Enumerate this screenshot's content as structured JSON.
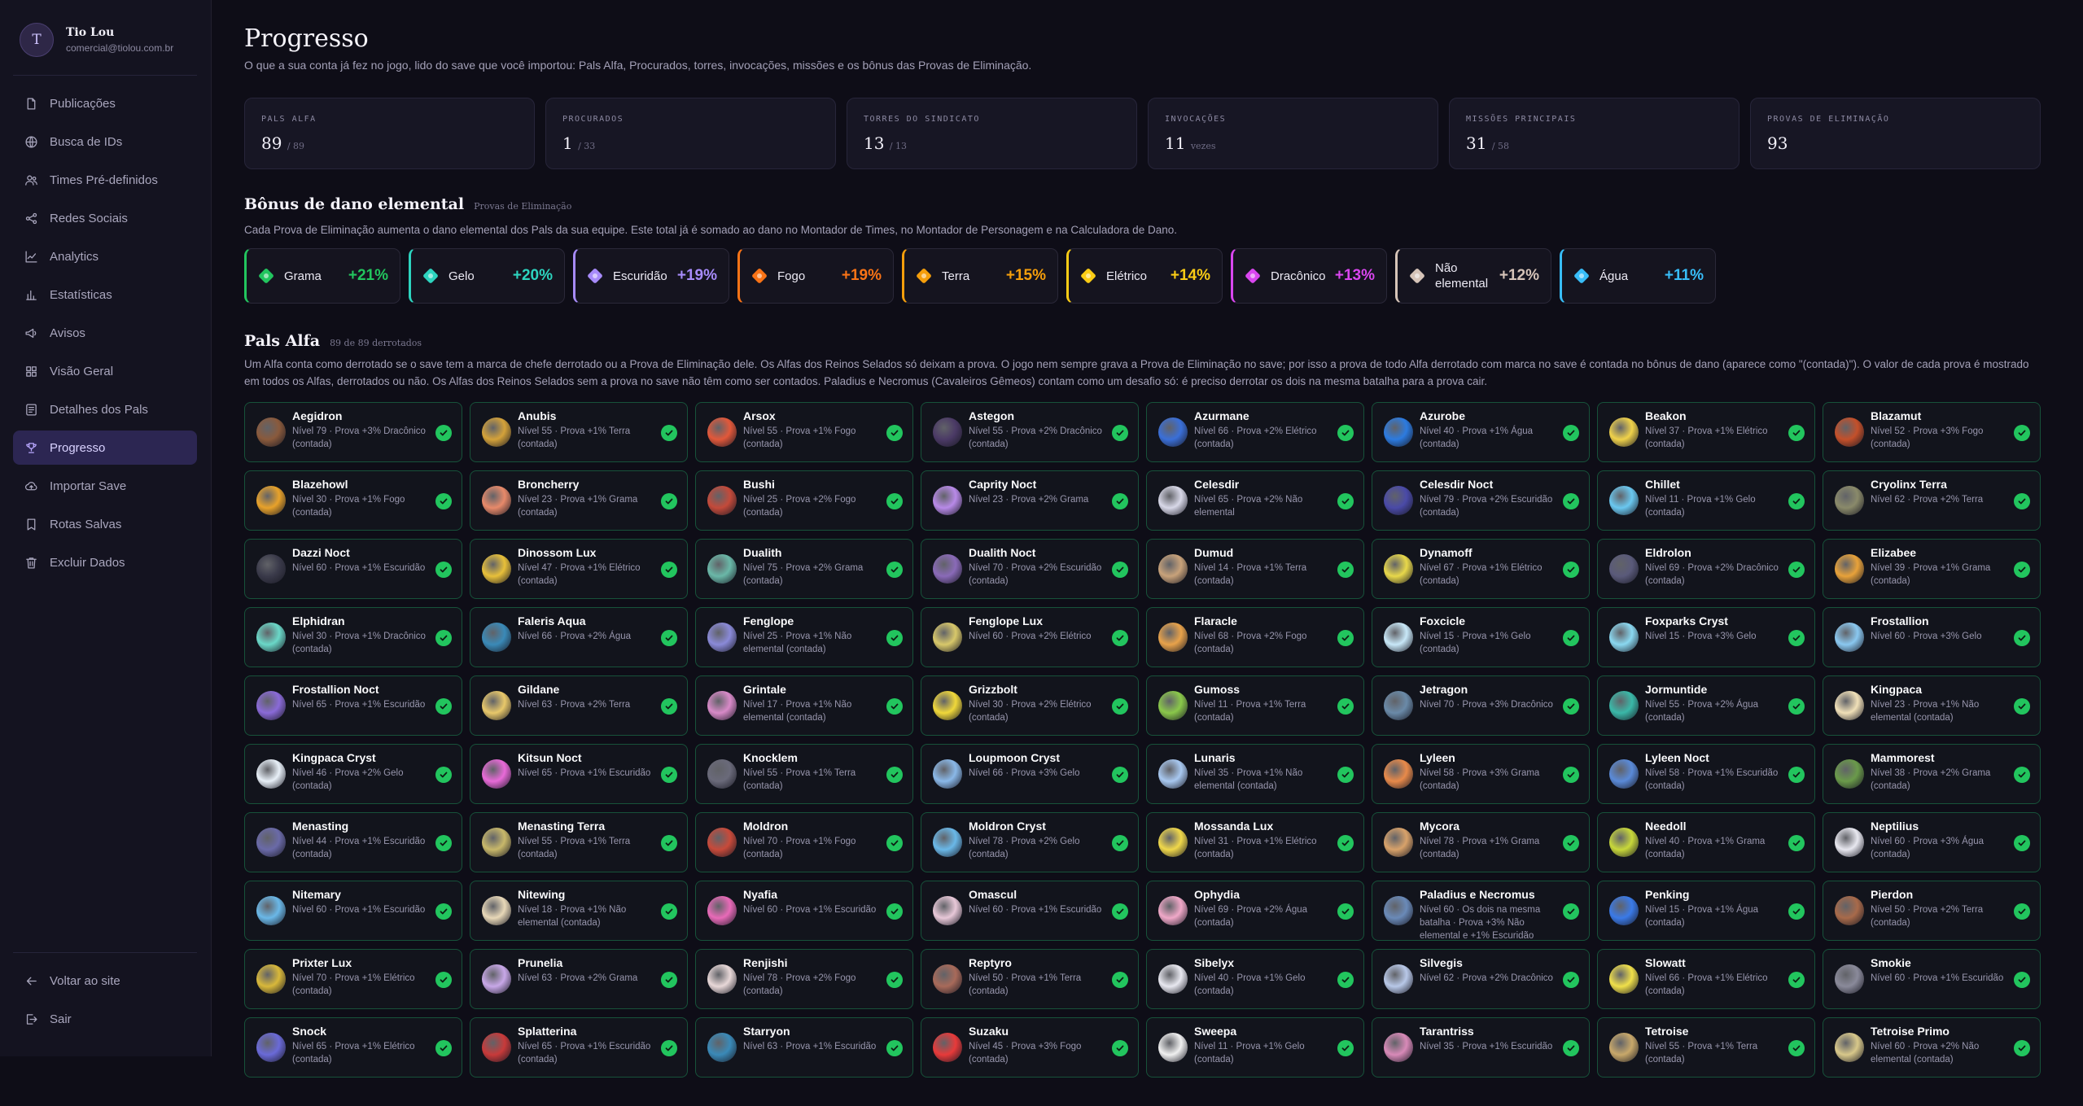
{
  "user": {
    "initial": "T",
    "name": "Tio Lou",
    "email": "comercial@tiolou.com.br"
  },
  "nav": [
    {
      "label": "Publicações",
      "icon": "file-icon"
    },
    {
      "label": "Busca de IDs",
      "icon": "globe-icon"
    },
    {
      "label": "Times Pré-definidos",
      "icon": "users-icon"
    },
    {
      "label": "Redes Sociais",
      "icon": "share-icon"
    },
    {
      "label": "Analytics",
      "icon": "line-chart-icon"
    },
    {
      "label": "Estatísticas",
      "icon": "bar-chart-icon"
    },
    {
      "label": "Avisos",
      "icon": "megaphone-icon"
    },
    {
      "label": "Visão Geral",
      "icon": "grid-icon"
    },
    {
      "label": "Detalhes dos Pals",
      "icon": "list-icon"
    },
    {
      "label": "Progresso",
      "icon": "trophy-icon",
      "active": true
    },
    {
      "label": "Importar Save",
      "icon": "cloud-upload-icon"
    },
    {
      "label": "Rotas Salvas",
      "icon": "bookmark-icon"
    },
    {
      "label": "Excluir Dados",
      "icon": "trash-icon"
    }
  ],
  "nav_bottom": [
    {
      "label": "Voltar ao site",
      "icon": "arrow-left-icon"
    },
    {
      "label": "Sair",
      "icon": "logout-icon"
    }
  ],
  "page": {
    "title": "Progresso",
    "subtitle": "O que a sua conta já fez no jogo, lido do save que você importou: Pals Alfa, Procurados, torres, invocações, missões e os bônus das Provas de Eliminação."
  },
  "stats": [
    {
      "label": "Pals Alfa",
      "value": "89",
      "total": "/ 89"
    },
    {
      "label": "Procurados",
      "value": "1",
      "total": "/ 33"
    },
    {
      "label": "Torres do Sindicato",
      "value": "13",
      "total": "/ 13"
    },
    {
      "label": "Invocações",
      "value": "11",
      "total": "vezes"
    },
    {
      "label": "Missões principais",
      "value": "31",
      "total": "/ 58"
    },
    {
      "label": "Provas de Eliminação",
      "value": "93",
      "total": ""
    }
  ],
  "bonus_section": {
    "title": "Bônus de dano elemental",
    "small": "Provas de Eliminação",
    "desc": "Cada Prova de Eliminação aumenta o dano elemental dos Pals da sua equipe. Este total já é somado ao dano no Montador de Times, no Montador de Personagem e na Calculadora de Dano."
  },
  "bonuses": [
    {
      "name": "Grama",
      "value": "+21%",
      "color": "#22c55e"
    },
    {
      "name": "Gelo",
      "value": "+20%",
      "color": "#2dd4bf"
    },
    {
      "name": "Escuridão",
      "value": "+19%",
      "color": "#a78bfa"
    },
    {
      "name": "Fogo",
      "value": "+19%",
      "color": "#f97316"
    },
    {
      "name": "Terra",
      "value": "+15%",
      "color": "#f59e0b"
    },
    {
      "name": "Elétrico",
      "value": "+14%",
      "color": "#facc15"
    },
    {
      "name": "Dracônico",
      "value": "+13%",
      "color": "#d946ef"
    },
    {
      "name": "Não elemental",
      "value": "+12%",
      "color": "#d6c4b8"
    },
    {
      "name": "Água",
      "value": "+11%",
      "color": "#38bdf8"
    }
  ],
  "alpha_section": {
    "title": "Pals Alfa",
    "small": "89 de 89 derrotados",
    "desc": "Um Alfa conta como derrotado se o save tem a marca de chefe derrotado ou a Prova de Eliminação dele. Os Alfas dos Reinos Selados só deixam a prova. O jogo nem sempre grava a Prova de Eliminação no save; por isso a prova de todo Alfa derrotado com marca no save é contada no bônus de dano (aparece como \"(contada)\"). O valor de cada prova é mostrado em todos os Alfas, derrotados ou não. Os Alfas dos Reinos Selados sem a prova no save não têm como ser contados. Paladius e Necromus (Cavaleiros Gêmeos) contam como um desafio só: é preciso derrotar os dois na mesma batalha para a prova cair."
  },
  "pals": [
    {
      "name": "Aegidron",
      "desc": "Nível 79 · Prova +3% Dracônico (contada)",
      "color": "#8a5a3c"
    },
    {
      "name": "Anubis",
      "desc": "Nível 55 · Prova +1% Terra (contada)",
      "color": "#d4a23a"
    },
    {
      "name": "Arsox",
      "desc": "Nível 55 · Prova +1% Fogo (contada)",
      "color": "#e2583a"
    },
    {
      "name": "Astegon",
      "desc": "Nível 55 · Prova +2% Dracônico (contada)",
      "color": "#4b3a66"
    },
    {
      "name": "Azurmane",
      "desc": "Nível 66 · Prova +2% Elétrico (contada)",
      "color": "#3a6fd8"
    },
    {
      "name": "Azurobe",
      "desc": "Nível 40 · Prova +1% Água (contada)",
      "color": "#2c7be0"
    },
    {
      "name": "Beakon",
      "desc": "Nível 37 · Prova +1% Elétrico (contada)",
      "color": "#f0d24a"
    },
    {
      "name": "Blazamut",
      "desc": "Nível 52 · Prova +3% Fogo (contada)",
      "color": "#c4502a"
    },
    {
      "name": "Blazehowl",
      "desc": "Nível 30 · Prova +1% Fogo (contada)",
      "color": "#e8a22a"
    },
    {
      "name": "Broncherry",
      "desc": "Nível 23 · Prova +1% Grama (contada)",
      "color": "#e88a6a"
    },
    {
      "name": "Bushi",
      "desc": "Nível 25 · Prova +2% Fogo (contada)",
      "color": "#c44a3a"
    },
    {
      "name": "Caprity Noct",
      "desc": "Nível 23 · Prova +2% Grama",
      "color": "#b88ae8"
    },
    {
      "name": "Celesdir",
      "desc": "Nível 65 · Prova +2% Não elemental",
      "color": "#d8d8e8"
    },
    {
      "name": "Celesdir Noct",
      "desc": "Nível 79 · Prova +2% Escuridão (contada)",
      "color": "#4a4aa8"
    },
    {
      "name": "Chillet",
      "desc": "Nível 11 · Prova +1% Gelo (contada)",
      "color": "#6ac8f0"
    },
    {
      "name": "Cryolinx Terra",
      "desc": "Nível 62 · Prova +2% Terra",
      "color": "#8a8a6a"
    },
    {
      "name": "Dazzi Noct",
      "desc": "Nível 60 · Prova +1% Escuridão",
      "color": "#3a3a4a"
    },
    {
      "name": "Dinossom Lux",
      "desc": "Nível 47 · Prova +1% Elétrico (contada)",
      "color": "#e8c03a"
    },
    {
      "name": "Dualith",
      "desc": "Nível 75 · Prova +2% Grama (contada)",
      "color": "#6ab8a8"
    },
    {
      "name": "Dualith Noct",
      "desc": "Nível 70 · Prova +2% Escuridão (contada)",
      "color": "#8a6ab8"
    },
    {
      "name": "Dumud",
      "desc": "Nível 14 · Prova +1% Terra (contada)",
      "color": "#c8a27a"
    },
    {
      "name": "Dynamoff",
      "desc": "Nível 67 · Prova +1% Elétrico (contada)",
      "color": "#e8d84a"
    },
    {
      "name": "Eldrolon",
      "desc": "Nível 69 · Prova +2% Dracônico (contada)",
      "color": "#5a5a7a"
    },
    {
      "name": "Elizabee",
      "desc": "Nível 39 · Prova +1% Grama (contada)",
      "color": "#e8a23a"
    },
    {
      "name": "Elphidran",
      "desc": "Nível 30 · Prova +1% Dracônico (contada)",
      "color": "#6ad8c8"
    },
    {
      "name": "Faleris Aqua",
      "desc": "Nível 66 · Prova +2% Água",
      "color": "#3a8ab8"
    },
    {
      "name": "Fenglope",
      "desc": "Nível 25 · Prova +1% Não elemental (contada)",
      "color": "#8a8ad8"
    },
    {
      "name": "Fenglope Lux",
      "desc": "Nível 60 · Prova +2% Elétrico",
      "color": "#d8c86a"
    },
    {
      "name": "Flaracle",
      "desc": "Nível 68 · Prova +2% Fogo (contada)",
      "color": "#e8a24a"
    },
    {
      "name": "Foxcicle",
      "desc": "Nível 15 · Prova +1% Gelo (contada)",
      "color": "#c8e8f8"
    },
    {
      "name": "Foxparks Cryst",
      "desc": "Nível 15 · Prova +3% Gelo",
      "color": "#8ad8f0"
    },
    {
      "name": "Frostallion",
      "desc": "Nível 60 · Prova +3% Gelo",
      "color": "#8ac8f0"
    },
    {
      "name": "Frostallion Noct",
      "desc": "Nível 65 · Prova +1% Escuridão",
      "color": "#8a6ad8"
    },
    {
      "name": "Gildane",
      "desc": "Nível 63 · Prova +2% Terra",
      "color": "#e8c86a"
    },
    {
      "name": "Grintale",
      "desc": "Nível 17 · Prova +1% Não elemental (contada)",
      "color": "#d88ac8"
    },
    {
      "name": "Grizzbolt",
      "desc": "Nível 30 · Prova +2% Elétrico (contada)",
      "color": "#f0d83a"
    },
    {
      "name": "Gumoss",
      "desc": "Nível 11 · Prova +1% Terra (contada)",
      "color": "#8ac84a"
    },
    {
      "name": "Jetragon",
      "desc": "Nível 70 · Prova +3% Dracônico",
      "color": "#6a8aa8"
    },
    {
      "name": "Jormuntide",
      "desc": "Nível 55 · Prova +2% Água (contada)",
      "color": "#3ab8a8"
    },
    {
      "name": "Kingpaca",
      "desc": "Nível 23 · Prova +1% Não elemental (contada)",
      "color": "#f0e0b8"
    },
    {
      "name": "Kingpaca Cryst",
      "desc": "Nível 46 · Prova +2% Gelo (contada)",
      "color": "#e8f0f8"
    },
    {
      "name": "Kitsun Noct",
      "desc": "Nível 65 · Prova +1% Escuridão",
      "color": "#e86ad8"
    },
    {
      "name": "Knocklem",
      "desc": "Nível 55 · Prova +1% Terra (contada)",
      "color": "#6a6a7a"
    },
    {
      "name": "Loupmoon Cryst",
      "desc": "Nível 66 · Prova +3% Gelo",
      "color": "#8ab8e8"
    },
    {
      "name": "Lunaris",
      "desc": "Nível 35 · Prova +1% Não elemental (contada)",
      "color": "#a8c8f0"
    },
    {
      "name": "Lyleen",
      "desc": "Nível 58 · Prova +3% Grama (contada)",
      "color": "#e88a4a"
    },
    {
      "name": "Lyleen Noct",
      "desc": "Nível 58 · Prova +1% Escuridão (contada)",
      "color": "#5a8ad8"
    },
    {
      "name": "Mammorest",
      "desc": "Nível 38 · Prova +2% Grama (contada)",
      "color": "#6a9a4a"
    },
    {
      "name": "Menasting",
      "desc": "Nível 44 · Prova +1% Escuridão (contada)",
      "color": "#6a6aa8"
    },
    {
      "name": "Menasting Terra",
      "desc": "Nível 55 · Prova +1% Terra (contada)",
      "color": "#c8b86a"
    },
    {
      "name": "Moldron",
      "desc": "Nível 70 · Prova +1% Fogo (contada)",
      "color": "#c84a3a"
    },
    {
      "name": "Moldron Cryst",
      "desc": "Nível 78 · Prova +2% Gelo (contada)",
      "color": "#6ab8e8"
    },
    {
      "name": "Mossanda Lux",
      "desc": "Nível 31 · Prova +1% Elétrico (contada)",
      "color": "#f0d84a"
    },
    {
      "name": "Mycora",
      "desc": "Nível 78 · Prova +1% Grama (contada)",
      "color": "#d8a26a"
    },
    {
      "name": "Needoll",
      "desc": "Nível 40 · Prova +1% Grama (contada)",
      "color": "#c8d83a"
    },
    {
      "name": "Neptilius",
      "desc": "Nível 60 · Prova +3% Água (contada)",
      "color": "#e8e8f0"
    },
    {
      "name": "Nitemary",
      "desc": "Nível 60 · Prova +1% Escuridão",
      "color": "#6ab8e8"
    },
    {
      "name": "Nitewing",
      "desc": "Nível 18 · Prova +1% Não elemental (contada)",
      "color": "#e8d8b8"
    },
    {
      "name": "Nyafia",
      "desc": "Nível 60 · Prova +1% Escuridão",
      "color": "#e86ab8"
    },
    {
      "name": "Omascul",
      "desc": "Nível 60 · Prova +1% Escuridão",
      "color": "#e8c8d8"
    },
    {
      "name": "Ophydia",
      "desc": "Nível 69 · Prova +2% Água (contada)",
      "color": "#f0a8c8"
    },
    {
      "name": "Paladius e Necromus",
      "desc": "Nível 60 · Os dois na mesma batalha · Prova +3% Não elemental e +1% Escuridão",
      "color": "#6a8ab8"
    },
    {
      "name": "Penking",
      "desc": "Nível 15 · Prova +1% Água (contada)",
      "color": "#3a7ae8"
    },
    {
      "name": "Pierdon",
      "desc": "Nível 50 · Prova +2% Terra (contada)",
      "color": "#a86a4a"
    },
    {
      "name": "Prixter Lux",
      "desc": "Nível 70 · Prova +1% Elétrico (contada)",
      "color": "#d8b83a"
    },
    {
      "name": "Prunelia",
      "desc": "Nível 63 · Prova +2% Grama",
      "color": "#c8a8e8"
    },
    {
      "name": "Renjishi",
      "desc": "Nível 78 · Prova +2% Fogo (contada)",
      "color": "#e8d8d8"
    },
    {
      "name": "Reptyro",
      "desc": "Nível 50 · Prova +1% Terra (contada)",
      "color": "#a86a5a"
    },
    {
      "name": "Sibelyx",
      "desc": "Nível 40 · Prova +1% Gelo (contada)",
      "color": "#e8e8f0"
    },
    {
      "name": "Silvegis",
      "desc": "Nível 62 · Prova +2% Dracônico",
      "color": "#b8c8e8"
    },
    {
      "name": "Slowatt",
      "desc": "Nível 66 · Prova +1% Elétrico (contada)",
      "color": "#f0e04a"
    },
    {
      "name": "Smokie",
      "desc": "Nível 60 · Prova +1% Escuridão",
      "color": "#8a8a9a"
    },
    {
      "name": "Snock",
      "desc": "Nível 65 · Prova +1% Elétrico (contada)",
      "color": "#6a6ad8"
    },
    {
      "name": "Splatterina",
      "desc": "Nível 65 · Prova +1% Escuridão (contada)",
      "color": "#c83a3a"
    },
    {
      "name": "Starryon",
      "desc": "Nível 63 · Prova +1% Escuridão",
      "color": "#3a8ab8"
    },
    {
      "name": "Suzaku",
      "desc": "Nível 45 · Prova +3% Fogo (contada)",
      "color": "#e83a3a"
    },
    {
      "name": "Sweepa",
      "desc": "Nível 11 · Prova +1% Gelo (contada)",
      "color": "#f0f0f0"
    },
    {
      "name": "Tarantriss",
      "desc": "Nível 35 · Prova +1% Escuridão",
      "color": "#d88ab8"
    },
    {
      "name": "Tetroise",
      "desc": "Nível 55 · Prova +1% Terra (contada)",
      "color": "#c8a86a"
    },
    {
      "name": "Tetroise Primo",
      "desc": "Nível 60 · Prova +2% Não elemental (contada)",
      "color": "#d8c88a"
    }
  ]
}
